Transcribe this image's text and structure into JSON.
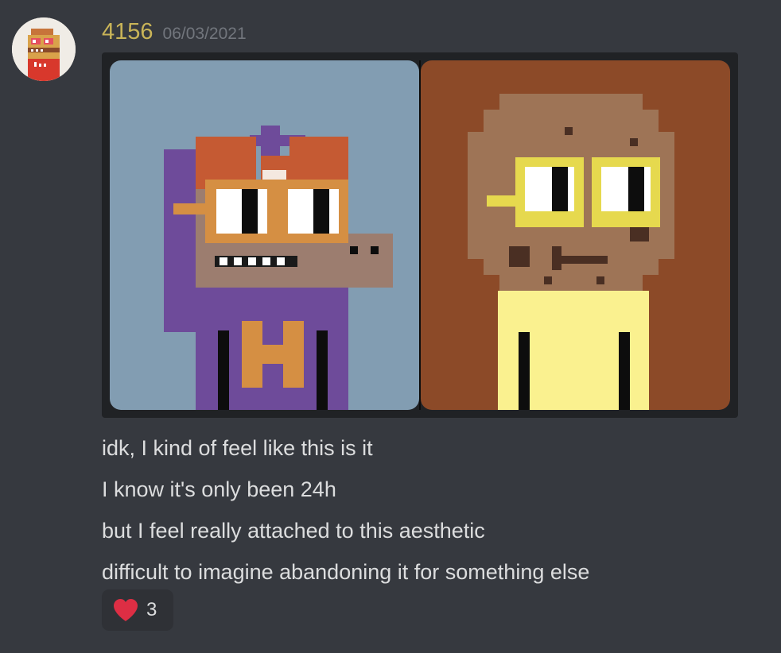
{
  "message": {
    "author": "4156",
    "timestamp": "06/03/2021",
    "avatar_icon": "pixel-punk-avatar",
    "lines": [
      "idk, I kind of feel like this is it",
      "I know it's only been 24h",
      "but I feel really attached to this aesthetic",
      "difficult to imagine abandoning it for something else"
    ],
    "reaction": {
      "icon": "heart-icon",
      "count": "3",
      "color": "#dd2e44"
    }
  },
  "colors": {
    "background": "#36393f",
    "username": "#c9b458",
    "timestamp": "#72767d",
    "text": "#dcddde"
  }
}
